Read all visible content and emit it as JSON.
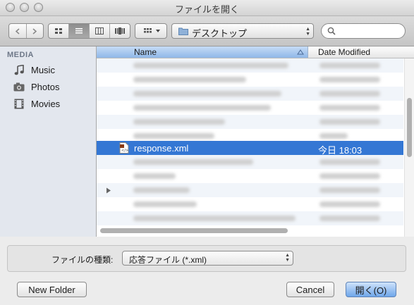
{
  "window": {
    "title": "ファイルを開く"
  },
  "toolbar": {
    "location": "デスクトップ",
    "search_placeholder": ""
  },
  "sidebar": {
    "section": "MEDIA",
    "items": [
      {
        "label": "Music",
        "icon": "music-note-icon"
      },
      {
        "label": "Photos",
        "icon": "camera-icon"
      },
      {
        "label": "Movies",
        "icon": "film-icon"
      }
    ]
  },
  "list": {
    "columns": {
      "name": "Name",
      "date": "Date Modified"
    },
    "selected_file": {
      "name": "response.xml",
      "date": "今日 18:03",
      "icon": "xml-file-icon"
    }
  },
  "bottom": {
    "format_label": "ファイルの種類:",
    "format_value": "応答ファイル (*.xml)"
  },
  "buttons": {
    "new_folder": "New Folder",
    "cancel": "Cancel",
    "open": "開く(O)"
  },
  "colors": {
    "selection": "#3477d4",
    "sidebar_bg": "#e3e7ee",
    "header_active": "#a9c8ef"
  }
}
